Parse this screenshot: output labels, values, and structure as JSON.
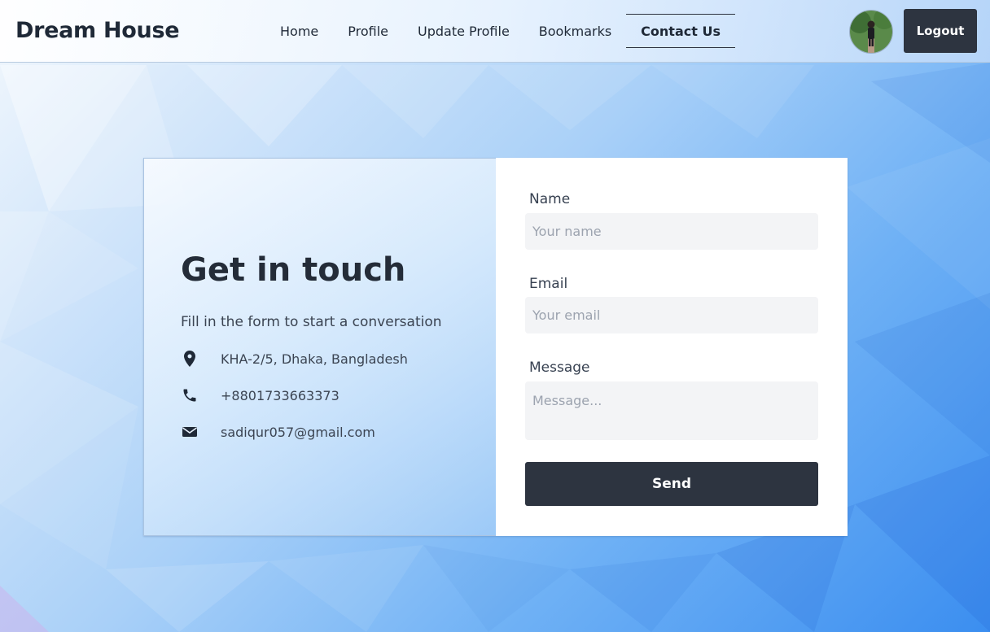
{
  "navbar": {
    "brand": "Dream House",
    "links": [
      {
        "label": "Home"
      },
      {
        "label": "Profile"
      },
      {
        "label": "Update Profile"
      },
      {
        "label": "Bookmarks"
      },
      {
        "label": "Contact Us",
        "active": true
      }
    ],
    "logout_label": "Logout"
  },
  "contact": {
    "heading": "Get in touch",
    "subtitle": "Fill in the form to start a conversation",
    "address": "KHA-2/5, Dhaka, Bangladesh",
    "phone": "+8801733663373",
    "email": "sadiqur057@gmail.com",
    "icons": [
      "location-pin-icon",
      "phone-icon",
      "envelope-icon"
    ]
  },
  "form": {
    "name_label": "Name",
    "name_placeholder": "Your name",
    "email_label": "Email",
    "email_placeholder": "Your email",
    "message_label": "Message",
    "message_placeholder": "Message...",
    "send_label": "Send"
  },
  "colors": {
    "button_dark": "#2d3440",
    "text_dark": "#1f2937",
    "input_bg": "#f3f4f6"
  }
}
